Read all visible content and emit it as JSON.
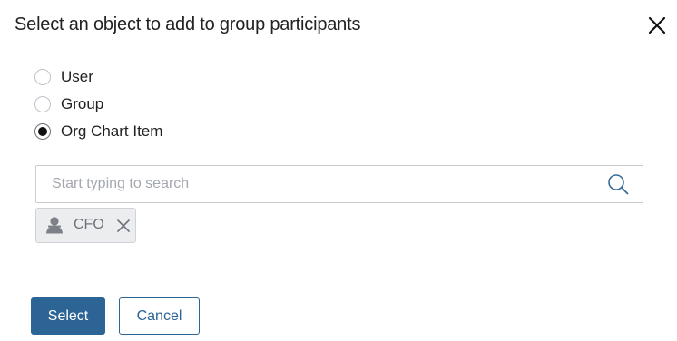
{
  "dialog": {
    "title": "Select an object to add to group participants",
    "close_icon": "close-icon"
  },
  "object_types": {
    "selected": "Org Chart Item",
    "options": [
      {
        "label": "User",
        "checked": false
      },
      {
        "label": "Group",
        "checked": false
      },
      {
        "label": "Org Chart Item",
        "checked": true
      }
    ]
  },
  "search": {
    "value": "",
    "placeholder": "Start typing to search",
    "icon": "search-icon"
  },
  "selected_items": [
    {
      "label": "CFO",
      "icon": "org-position-icon",
      "remove_icon": "remove-icon"
    }
  ],
  "actions": {
    "select_label": "Select",
    "cancel_label": "Cancel"
  },
  "colors": {
    "primary": "#2c6496",
    "tag_background": "#ebedef",
    "border": "#c9cdd2"
  }
}
